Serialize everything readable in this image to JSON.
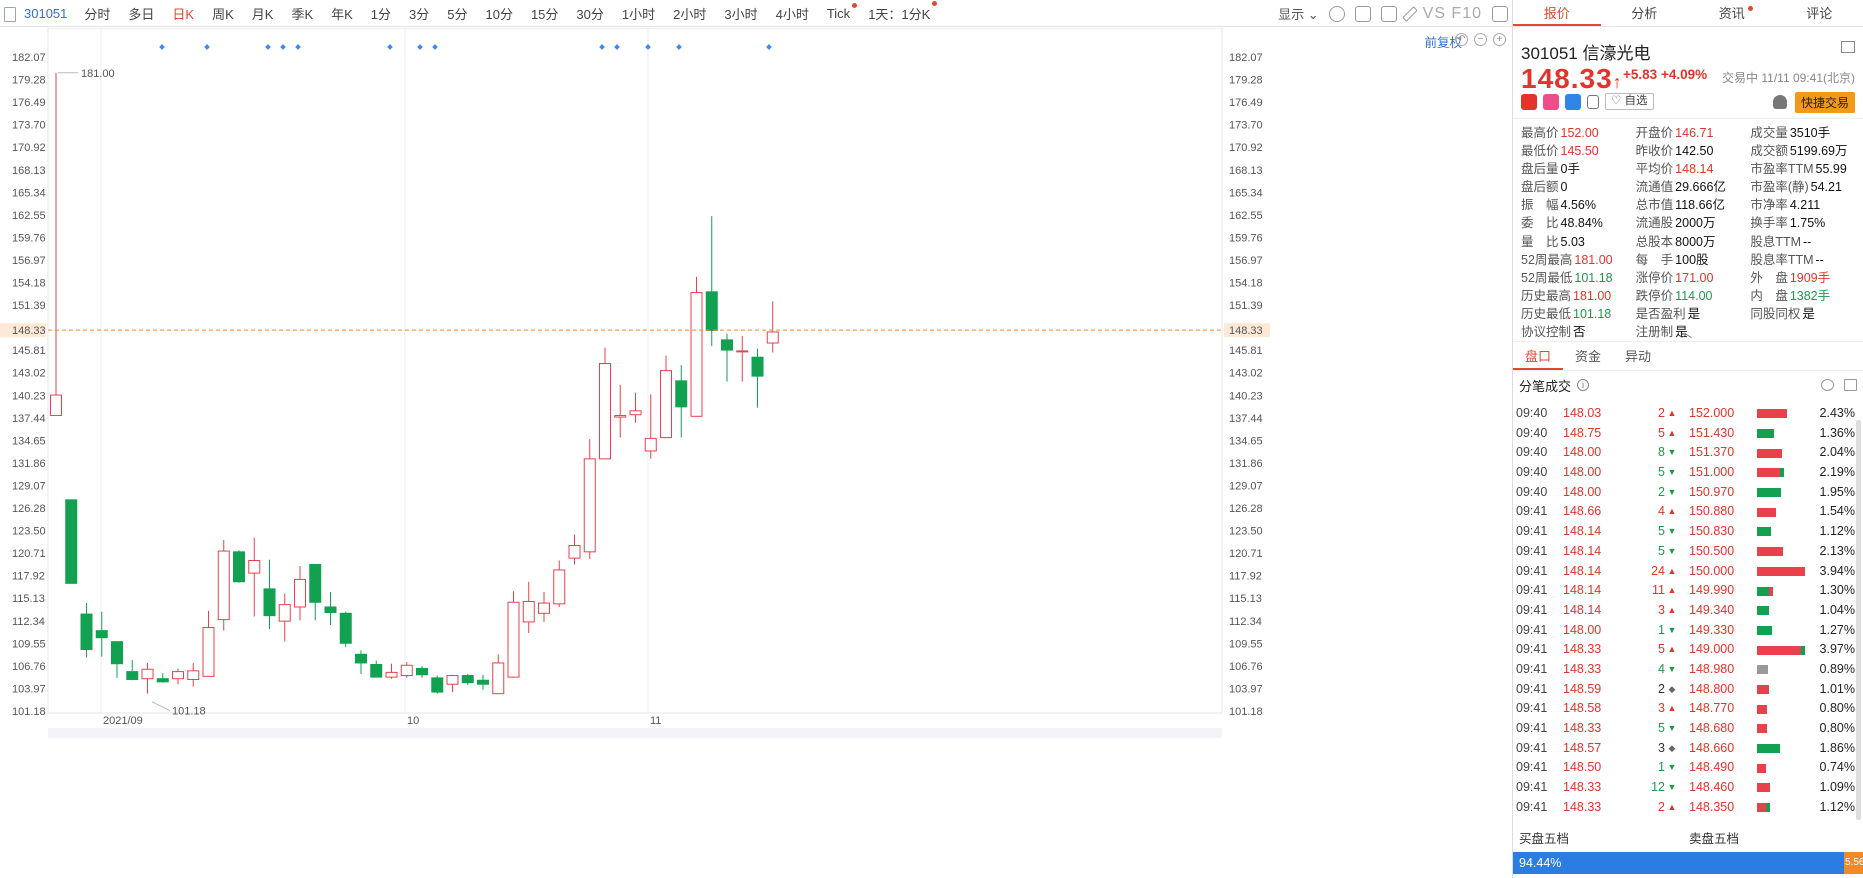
{
  "toolbar": {
    "code": "301051",
    "periods": [
      "分时",
      "多日",
      "日K",
      "周K",
      "月K",
      "季K",
      "年K",
      "1分",
      "3分",
      "5分",
      "10分",
      "15分",
      "30分",
      "1小时",
      "2小时",
      "3小时",
      "4小时",
      "Tick",
      "1天：1分K"
    ],
    "active_period": "日K",
    "display_label": "显示",
    "f10_label": "VS F10"
  },
  "chart": {
    "restore_label": "前复权",
    "current_price_label": "148.33",
    "max_label": "181.00",
    "min_label": "101.18",
    "y_ticks": [
      "182.07",
      "179.28",
      "176.49",
      "173.70",
      "170.92",
      "168.13",
      "165.34",
      "162.55",
      "159.76",
      "156.97",
      "154.18",
      "151.39",
      "148.60",
      "145.81",
      "143.02",
      "140.23",
      "137.44",
      "134.65",
      "131.86",
      "129.07",
      "126.28",
      "123.50",
      "120.71",
      "117.92",
      "115.13",
      "112.34",
      "109.55",
      "106.76",
      "103.97",
      "101.18"
    ],
    "x_labels": [
      "2021/09",
      "10",
      "11"
    ]
  },
  "chart_data": {
    "type": "candlestick",
    "ylim": [
      100.0,
      183.0
    ],
    "current_price": 148.33,
    "candles": [
      {
        "o": 137.5,
        "c": 140.1,
        "h": 181.0,
        "l": 137.5
      },
      {
        "o": 126.8,
        "c": 116.2,
        "h": 126.8,
        "l": 116.2
      },
      {
        "o": 112.3,
        "c": 107.8,
        "h": 113.7,
        "l": 106.8
      },
      {
        "o": 110.2,
        "c": 109.3,
        "h": 112.6,
        "l": 106.9
      },
      {
        "o": 108.8,
        "c": 106.0,
        "h": 108.8,
        "l": 104.2
      },
      {
        "o": 105.0,
        "c": 104.0,
        "h": 106.5,
        "l": 103.9
      },
      {
        "o": 104.1,
        "c": 105.3,
        "h": 106.1,
        "l": 102.2
      },
      {
        "o": 104.1,
        "c": 103.7,
        "h": 104.8,
        "l": 103.6
      },
      {
        "o": 104.1,
        "c": 105.0,
        "h": 105.4,
        "l": 103.4
      },
      {
        "o": 104.0,
        "c": 105.1,
        "h": 106.1,
        "l": 103.1
      },
      {
        "o": 104.4,
        "c": 110.6,
        "h": 112.7,
        "l": 104.4
      },
      {
        "o": 111.6,
        "c": 120.3,
        "h": 121.7,
        "l": 110.2
      },
      {
        "o": 120.2,
        "c": 116.4,
        "h": 120.4,
        "l": 116.3
      },
      {
        "o": 117.5,
        "c": 119.1,
        "h": 122.0,
        "l": 112.0
      },
      {
        "o": 115.5,
        "c": 112.1,
        "h": 119.2,
        "l": 110.4
      },
      {
        "o": 111.4,
        "c": 113.5,
        "h": 114.9,
        "l": 108.8
      },
      {
        "o": 113.2,
        "c": 116.7,
        "h": 118.4,
        "l": 111.5
      },
      {
        "o": 118.6,
        "c": 113.8,
        "h": 118.6,
        "l": 111.5
      },
      {
        "o": 113.2,
        "c": 112.5,
        "h": 115.1,
        "l": 110.9
      },
      {
        "o": 112.4,
        "c": 108.6,
        "h": 112.6,
        "l": 108.1
      },
      {
        "o": 107.2,
        "c": 106.1,
        "h": 107.7,
        "l": 104.7
      },
      {
        "o": 105.9,
        "c": 104.3,
        "h": 106.4,
        "l": 104.3
      },
      {
        "o": 104.3,
        "c": 104.9,
        "h": 106.0,
        "l": 104.1
      },
      {
        "o": 104.5,
        "c": 105.8,
        "h": 106.2,
        "l": 104.2
      },
      {
        "o": 105.4,
        "c": 104.6,
        "h": 105.7,
        "l": 104.2
      },
      {
        "o": 104.2,
        "c": 102.4,
        "h": 104.5,
        "l": 102.2
      },
      {
        "o": 103.4,
        "c": 104.5,
        "h": 104.6,
        "l": 102.4
      },
      {
        "o": 104.5,
        "c": 103.6,
        "h": 104.7,
        "l": 103.3
      },
      {
        "o": 103.9,
        "c": 103.4,
        "h": 104.6,
        "l": 102.7
      },
      {
        "o": 102.2,
        "c": 106.1,
        "h": 107.2,
        "l": 102.2
      },
      {
        "o": 104.3,
        "c": 113.8,
        "h": 115.2,
        "l": 104.3
      },
      {
        "o": 111.3,
        "c": 113.9,
        "h": 116.4,
        "l": 109.9
      },
      {
        "o": 112.4,
        "c": 113.7,
        "h": 115.1,
        "l": 111.3
      },
      {
        "o": 113.6,
        "c": 117.9,
        "h": 119.1,
        "l": 113.2
      },
      {
        "o": 119.4,
        "c": 121.0,
        "h": 122.4,
        "l": 118.6
      },
      {
        "o": 120.2,
        "c": 132.0,
        "h": 134.5,
        "l": 119.3
      },
      {
        "o": 132.0,
        "c": 144.1,
        "h": 146.1,
        "l": 132.0
      },
      {
        "o": 137.3,
        "c": 137.5,
        "h": 141.4,
        "l": 134.7
      },
      {
        "o": 137.6,
        "c": 138.1,
        "h": 140.4,
        "l": 136.6
      },
      {
        "o": 133.0,
        "c": 134.6,
        "h": 140.2,
        "l": 132.0
      },
      {
        "o": 134.7,
        "c": 143.2,
        "h": 145.1,
        "l": 134.6
      },
      {
        "o": 141.9,
        "c": 138.6,
        "h": 143.9,
        "l": 134.7
      },
      {
        "o": 137.4,
        "c": 153.1,
        "h": 155.1,
        "l": 137.4
      },
      {
        "o": 153.2,
        "c": 148.3,
        "h": 162.8,
        "l": 146.3
      },
      {
        "o": 147.1,
        "c": 145.8,
        "h": 147.9,
        "l": 141.8
      },
      {
        "o": 145.7,
        "c": 145.7,
        "h": 147.6,
        "l": 141.8
      },
      {
        "o": 144.9,
        "c": 142.5,
        "h": 146.0,
        "l": 138.5
      },
      {
        "o": 146.7,
        "c": 148.1,
        "h": 152.0,
        "l": 145.5
      }
    ]
  },
  "panel": {
    "tabs": [
      "报价",
      "分析",
      "资讯",
      "评论"
    ],
    "code": "301051",
    "name": "信濠光电",
    "price": "148.33",
    "arrow": "↑",
    "change": "+5.83",
    "change_pct": "+4.09%",
    "status_time": "交易中 11/11 09:41(北京)",
    "fav_label": "♡ 自选",
    "trade_label": "快捷交易",
    "stats": [
      [
        [
          "最高价",
          "152.00",
          "up"
        ],
        [
          "开盘价",
          "146.71",
          "up"
        ],
        [
          "成交量",
          "3510手",
          ""
        ]
      ],
      [
        [
          "最低价",
          "145.50",
          "up"
        ],
        [
          "昨收价",
          "142.50",
          ""
        ],
        [
          "成交额",
          "5199.69万",
          ""
        ]
      ],
      [
        [
          "盘后量",
          "0手",
          ""
        ],
        [
          "平均价",
          "148.14",
          "up"
        ],
        [
          "市盈率TTM",
          "55.99",
          ""
        ]
      ],
      [
        [
          "盘后额",
          "0",
          ""
        ],
        [
          "流通值",
          "29.666亿",
          ""
        ],
        [
          "市盈率(静)",
          "54.21",
          ""
        ]
      ],
      [
        [
          "振　幅",
          "4.56%",
          ""
        ],
        [
          "总市值",
          "118.66亿",
          ""
        ],
        [
          "市净率",
          "4.211",
          ""
        ]
      ],
      [
        [
          "委　比",
          "48.84%",
          ""
        ],
        [
          "流通股",
          "2000万",
          ""
        ],
        [
          "换手率",
          "1.75%",
          ""
        ]
      ],
      [
        [
          "量　比",
          "5.03",
          ""
        ],
        [
          "总股本",
          "8000万",
          ""
        ],
        [
          "股息TTM",
          "--",
          ""
        ]
      ],
      [
        [
          "52周最高",
          "181.00",
          "up"
        ],
        [
          "每　手",
          "100股",
          ""
        ],
        [
          "股息率TTM",
          "--",
          ""
        ]
      ],
      [
        [
          "52周最低",
          "101.18",
          "dn"
        ],
        [
          "涨停价",
          "171.00",
          "up"
        ],
        [
          "外　盘",
          "1909手",
          "up"
        ]
      ],
      [
        [
          "历史最高",
          "181.00",
          "up"
        ],
        [
          "跌停价",
          "114.00",
          "dn"
        ],
        [
          "内　盘",
          "1382手",
          "dn"
        ]
      ],
      [
        [
          "历史最低",
          "101.18",
          "dn"
        ],
        [
          "是否盈利",
          "是",
          ""
        ],
        [
          "同股同权",
          "是",
          ""
        ]
      ],
      [
        [
          "协议控制",
          "否",
          ""
        ],
        [
          "注册制",
          "是",
          ""
        ],
        [
          "",
          "",
          " "
        ]
      ]
    ],
    "subtabs": [
      "盘口",
      "资金",
      "异动"
    ],
    "tick_title": "分笔成交",
    "ticks": [
      [
        "09:40",
        "148.03",
        "2",
        "up"
      ],
      [
        "09:40",
        "148.75",
        "5",
        "up"
      ],
      [
        "09:40",
        "148.00",
        "8",
        "dn"
      ],
      [
        "09:40",
        "148.00",
        "5",
        "dn"
      ],
      [
        "09:40",
        "148.00",
        "2",
        "dn"
      ],
      [
        "09:41",
        "148.66",
        "4",
        "up"
      ],
      [
        "09:41",
        "148.14",
        "5",
        "dn"
      ],
      [
        "09:41",
        "148.14",
        "5",
        "dn"
      ],
      [
        "09:41",
        "148.14",
        "24",
        "up"
      ],
      [
        "09:41",
        "148.14",
        "11",
        "up"
      ],
      [
        "09:41",
        "148.14",
        "3",
        "up"
      ],
      [
        "09:41",
        "148.00",
        "1",
        "dn"
      ],
      [
        "09:41",
        "148.33",
        "5",
        "up"
      ],
      [
        "09:41",
        "148.33",
        "4",
        "dn"
      ],
      [
        "09:41",
        "148.59",
        "2",
        "nt"
      ],
      [
        "09:41",
        "148.58",
        "3",
        "up"
      ],
      [
        "09:41",
        "148.33",
        "5",
        "dn"
      ],
      [
        "09:41",
        "148.57",
        "3",
        "nt"
      ],
      [
        "09:41",
        "148.50",
        "1",
        "dn"
      ],
      [
        "09:41",
        "148.33",
        "12",
        "dn"
      ],
      [
        "09:41",
        "148.33",
        "2",
        "up"
      ]
    ],
    "book": [
      [
        "152.000",
        0.62,
        "2.43%",
        "r"
      ],
      [
        "151.430",
        0.35,
        "1.36%",
        "g"
      ],
      [
        "151.370",
        0.52,
        "2.04%",
        "r"
      ],
      [
        "151.000",
        0.56,
        "2.19%",
        "rg"
      ],
      [
        "150.970",
        0.5,
        "1.95%",
        "g"
      ],
      [
        "150.880",
        0.39,
        "1.54%",
        "r"
      ],
      [
        "150.830",
        0.29,
        "1.12%",
        "g"
      ],
      [
        "150.500",
        0.54,
        "2.13%",
        "r"
      ],
      [
        "150.000",
        1.0,
        "3.94%",
        "r"
      ],
      [
        "149.990",
        0.33,
        "1.30%",
        "gr"
      ],
      [
        "149.340",
        0.26,
        "1.04%",
        "g"
      ],
      [
        "149.330",
        0.32,
        "1.27%",
        "g"
      ],
      [
        "149.000",
        1.0,
        "3.97%",
        "rg"
      ],
      [
        "148.980",
        0.23,
        "0.89%",
        "gy"
      ],
      [
        "148.800",
        0.26,
        "1.01%",
        "r"
      ],
      [
        "148.770",
        0.2,
        "0.80%",
        "r"
      ],
      [
        "148.680",
        0.2,
        "0.80%",
        "r"
      ],
      [
        "148.660",
        0.47,
        "1.86%",
        "g"
      ],
      [
        "148.490",
        0.19,
        "0.74%",
        "r"
      ],
      [
        "148.460",
        0.28,
        "1.09%",
        "r"
      ],
      [
        "148.350",
        0.28,
        "1.12%",
        "rg"
      ]
    ],
    "buy_five": "买盘五档",
    "sell_five": "卖盘五档",
    "buy_pct": "94.44%",
    "sell_pct": "5.56%"
  }
}
